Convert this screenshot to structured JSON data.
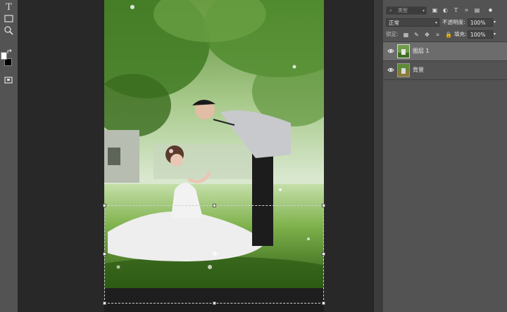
{
  "toolbar": {
    "tools": [
      "type-tool-icon",
      "rectangle-tool-icon",
      "zoom-tool-icon",
      "swap-colors-icon",
      "foreground-color-swatch",
      "background-color-swatch",
      "screen-mode-icon"
    ],
    "type_glyph": "T"
  },
  "layers_panel": {
    "search_placeholder": "类型",
    "filter_icons": [
      "image-filter-icon",
      "adjustment-filter-icon",
      "type-filter-icon",
      "shape-filter-icon",
      "smart-object-filter-icon",
      "filter-toggle-icon"
    ],
    "blend_mode": "正常",
    "opacity_label": "不透明度:",
    "opacity_value": "100%",
    "lock_label": "锁定:",
    "lock_icons": [
      "lock-transparent-icon",
      "lock-image-icon",
      "lock-position-icon",
      "lock-artboard-icon",
      "lock-all-icon"
    ],
    "fill_label": "填充:",
    "fill_value": "100%",
    "layers": [
      {
        "name": "图层 1",
        "visible": true,
        "selected": true
      },
      {
        "name": "背景",
        "visible": true,
        "selected": false
      }
    ]
  },
  "colors": {
    "panel_bg": "#535353",
    "canvas_bg": "#282828",
    "selected_layer": "#6c6c6c"
  }
}
